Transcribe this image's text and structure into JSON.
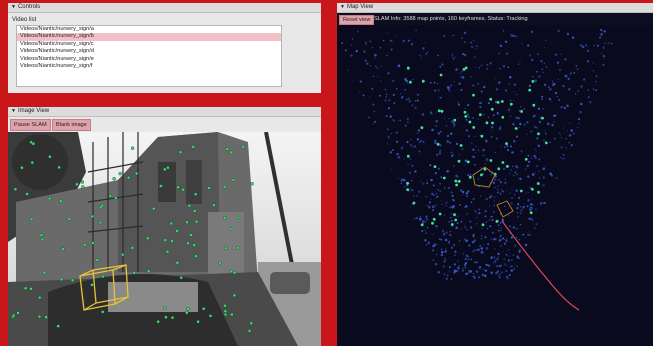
{
  "controls": {
    "title": "Controls",
    "list_label": "Video list",
    "videos": [
      "Videos/Niantic/nursery_sign/a",
      "Videos/Niantic/nursery_sign/b",
      "Videos/Niantic/nursery_sign/c",
      "Videos/Niantic/nursery_sign/d",
      "Videos/Niantic/nursery_sign/e",
      "Videos/Niantic/nursery_sign/f"
    ],
    "selected_index": 1
  },
  "image_view": {
    "title": "Image View",
    "pause_label": "Pause SLAM",
    "blank_label": "Blank image"
  },
  "map_view": {
    "title": "Map View",
    "reset_label": "Reset view",
    "slam_info": "SLAM Info: 3588 map points, 160 keyframes.   Status: Tracking"
  },
  "colors": {
    "background": "#c8161a",
    "feature_point": "#38e070",
    "camera_frustum": "#e8c23a",
    "map_point": "#3a63d8",
    "trajectory": "#d9485a",
    "selected_item": "#f0c2c8",
    "button": "#e0a2aa"
  }
}
